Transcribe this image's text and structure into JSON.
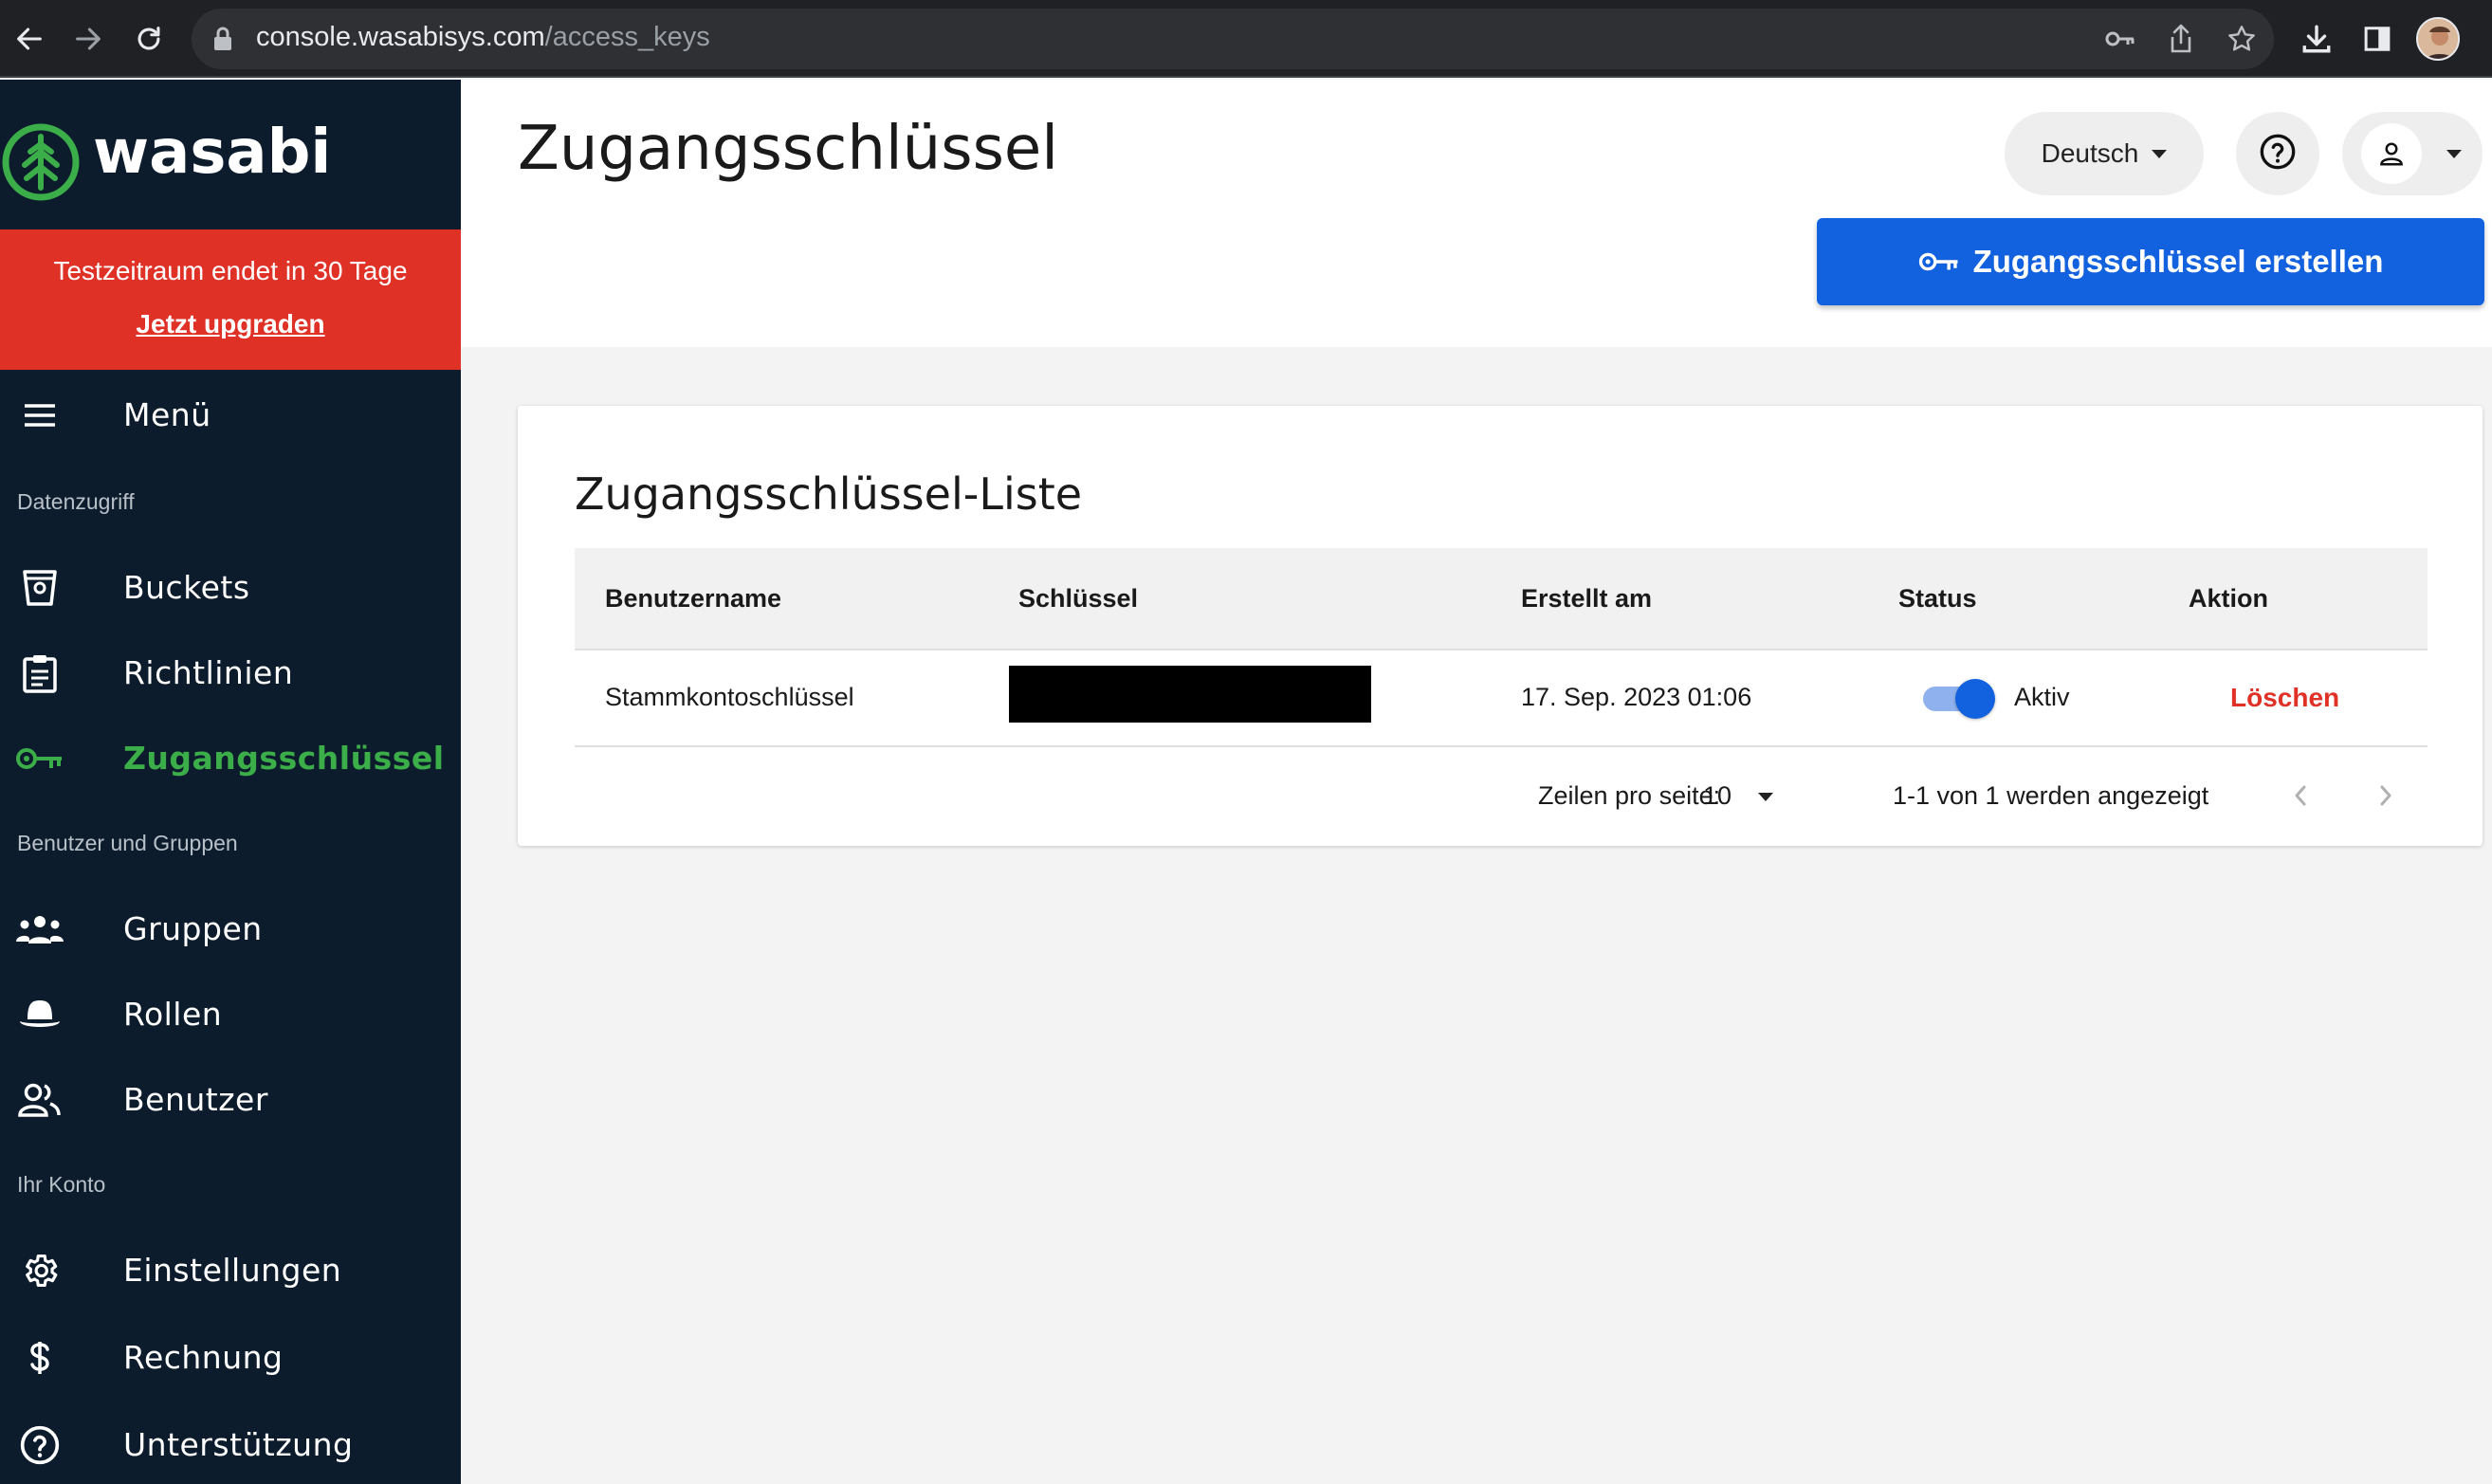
{
  "browser": {
    "url_host": "console.wasabisys.com",
    "url_path": "/access_keys"
  },
  "brand": {
    "name": "wasabi",
    "color": "#3cae49"
  },
  "trial": {
    "message": "Testzeitraum endet in 30 Tage",
    "upgrade_link": "Jetzt upgraden"
  },
  "sidebar": {
    "menu_label": "Menü",
    "sections": {
      "data_access": "Datenzugriff",
      "users_groups": "Benutzer und Gruppen",
      "account": "Ihr Konto"
    },
    "items": {
      "buckets": "Buckets",
      "policies": "Richtlinien",
      "access_keys": "Zugangsschlüssel",
      "groups": "Gruppen",
      "roles": "Rollen",
      "users": "Benutzer",
      "settings": "Einstellungen",
      "billing": "Rechnung",
      "support": "Unterstützung"
    }
  },
  "header": {
    "title": "Zugangsschlüssel",
    "language": "Deutsch",
    "create_button": "Zugangsschlüssel erstellen"
  },
  "card": {
    "title": "Zugangsschlüssel-Liste",
    "columns": {
      "username": "Benutzername",
      "key": "Schlüssel",
      "created": "Erstellt am",
      "status": "Status",
      "action": "Aktion"
    },
    "rows": [
      {
        "username": "Stammkontoschlüssel",
        "created": "17. Sep. 2023 01:06",
        "status": "Aktiv",
        "action": "Löschen"
      }
    ],
    "pagination": {
      "rows_per_page_label": "Zeilen pro seite:",
      "rows_per_page": "10",
      "range": "1-1 von 1 werden angezeigt"
    }
  },
  "colors": {
    "primary": "#1261de",
    "danger": "#e03127",
    "sidebar_bg": "#0c1c2c",
    "active": "#3cae49"
  }
}
